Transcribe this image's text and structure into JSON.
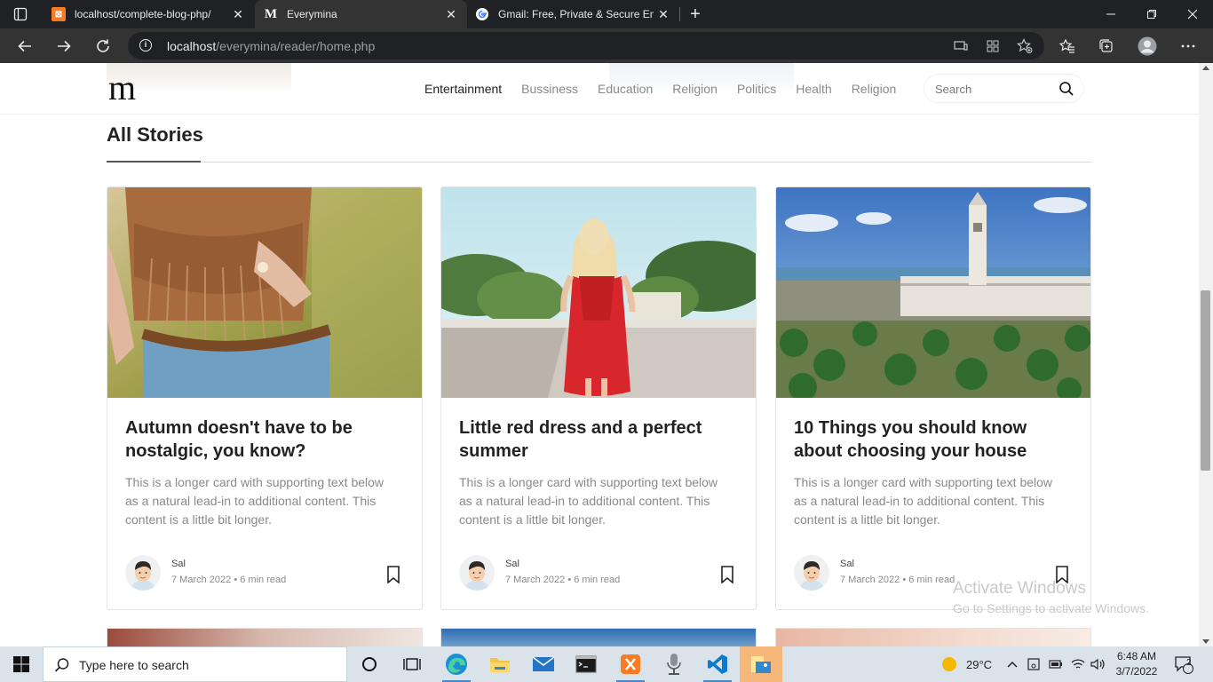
{
  "browser": {
    "tabs": [
      {
        "title": "localhost/complete-blog-php/",
        "favicon": "xampp-icon"
      },
      {
        "title": "Everymina",
        "favicon": "medium-m-icon"
      },
      {
        "title": "Gmail: Free, Private & Secure Em",
        "favicon": "google-g-icon"
      }
    ],
    "address": {
      "host": "localhost",
      "path": "/everymina/reader/home.php"
    }
  },
  "site": {
    "logo": "m",
    "nav": [
      "Entertainment",
      "Bussiness",
      "Education",
      "Religion",
      "Politics",
      "Health",
      "Religion"
    ],
    "search_placeholder": "Search"
  },
  "section": {
    "title": "All Stories"
  },
  "cards": [
    {
      "title": "Autumn doesn't have to be nostalgic, you know?",
      "text": "This is a longer card with supporting text below as a natural lead-in to additional content. This content is a little bit longer.",
      "author": "Sal",
      "meta": "7 March 2022 • 6 min read"
    },
    {
      "title": "Little red dress and a perfect summer",
      "text": "This is a longer card with supporting text below as a natural lead-in to additional content. This content is a little bit longer.",
      "author": "Sal",
      "meta": "7 March 2022 • 6 min read"
    },
    {
      "title": "10 Things you should know about choosing your house",
      "text": "This is a longer card with supporting text below as a natural lead-in to additional content. This content is a little bit longer.",
      "author": "Sal",
      "meta": "7 March 2022 • 6 min read"
    }
  ],
  "watermark": {
    "line1": "Activate Windows",
    "line2": "Go to Settings to activate Windows."
  },
  "taskbar": {
    "search_placeholder": "Type here to search",
    "weather": "29°C",
    "time": "6:48 AM",
    "date": "3/7/2022",
    "notifications": "2"
  },
  "colors": {
    "browser_dark": "#202124",
    "toolbar": "#333333",
    "taskbar": "#dbe3ea",
    "accent": "#4a88c7"
  }
}
